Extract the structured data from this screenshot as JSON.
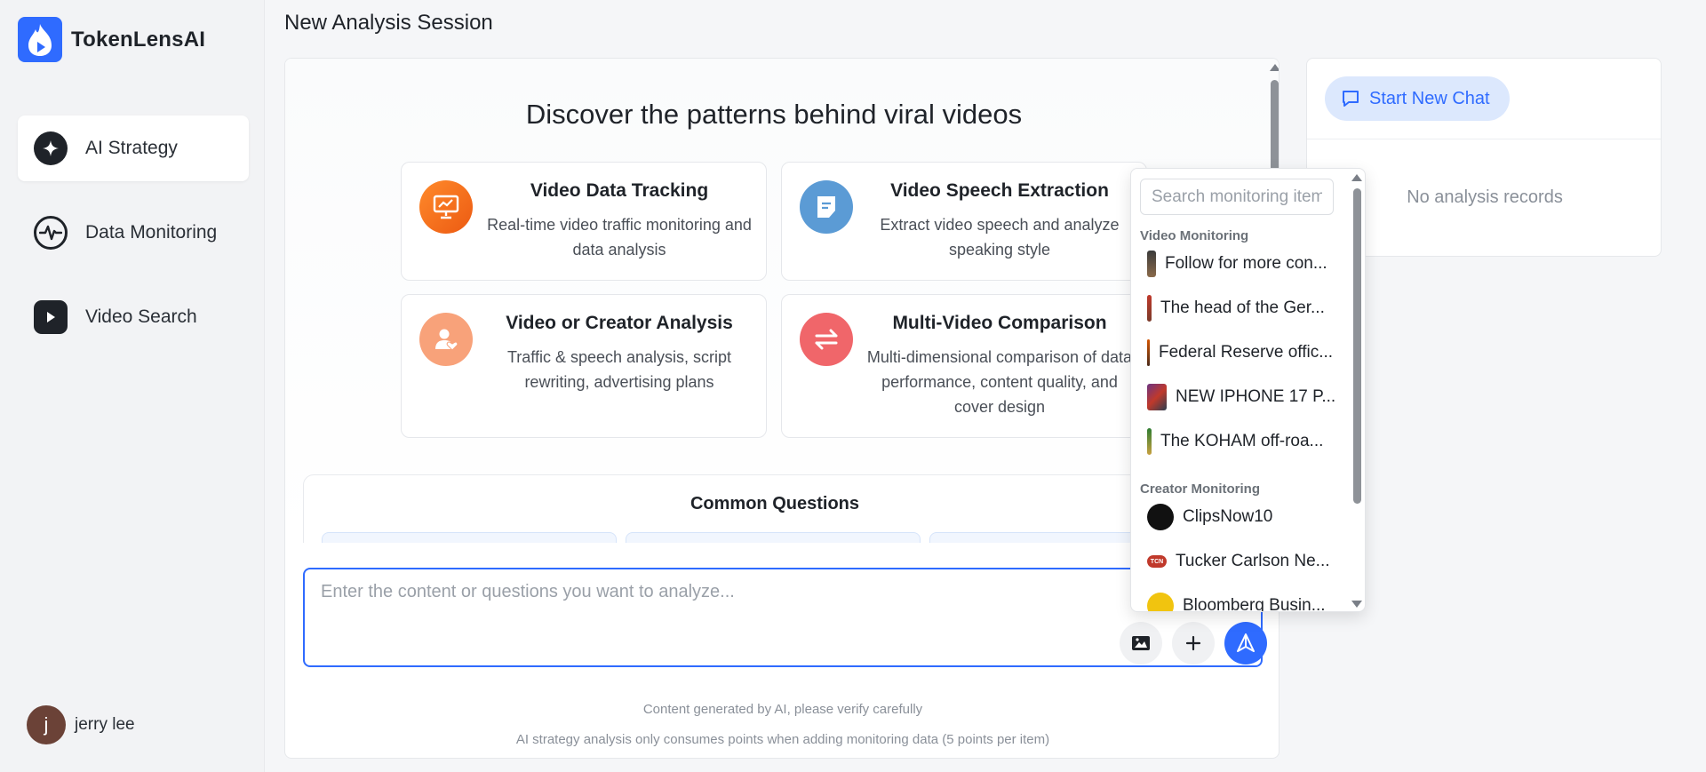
{
  "brand": {
    "name": "TokenLensAI",
    "color": "#2f6bff"
  },
  "sidebar": {
    "items": [
      {
        "label": "AI Strategy",
        "icon": "sparkle-icon",
        "active": true
      },
      {
        "label": "Data Monitoring",
        "icon": "pulse-icon",
        "active": false
      },
      {
        "label": "Video Search",
        "icon": "play-icon",
        "active": false
      }
    ],
    "user": {
      "initial": "j",
      "name": "jerry lee"
    }
  },
  "header": {
    "title": "New Analysis Session"
  },
  "main": {
    "hero_title": "Discover the patterns behind viral videos",
    "cards": [
      {
        "title": "Video Data Tracking",
        "desc": "Real-time video traffic monitoring and data analysis",
        "icon": "chart-board-icon",
        "color": "#f26b1d"
      },
      {
        "title": "Video Speech Extraction",
        "desc": "Extract video speech and analyze speaking style",
        "icon": "document-icon",
        "color": "#5b9bd5"
      },
      {
        "title": "Video or Creator Analysis",
        "desc": "Traffic & speech analysis, script rewriting, advertising plans",
        "icon": "user-heart-icon",
        "color": "#f59a6b"
      },
      {
        "title": "Multi-Video Comparison",
        "desc": "Multi-dimensional comparison of data performance, content quality, and cover design",
        "icon": "swap-icon",
        "color": "#f0666a"
      }
    ],
    "common_questions_title": "Common Questions",
    "composer_placeholder": "Enter the content or questions you want to analyze...",
    "footnote_1": "Content generated by AI, please verify carefully",
    "footnote_2": "AI strategy analysis only consumes points when adding monitoring data (5 points per item)"
  },
  "right_panel": {
    "new_chat_label": "Start New Chat",
    "empty_text": "No analysis records"
  },
  "dropdown": {
    "search_placeholder": "Search monitoring items",
    "video_group": "Video Monitoring",
    "video_items": [
      "Follow for more con...",
      "The head of the Ger...",
      "Federal Reserve offic...",
      "NEW IPHONE 17 P...",
      "The KOHAM off-roa..."
    ],
    "creator_group": "Creator Monitoring",
    "creator_items": [
      "ClipsNow10",
      "Tucker Carlson Ne...",
      "Bloomberg Busin..."
    ],
    "creator_badge": "TCN"
  }
}
